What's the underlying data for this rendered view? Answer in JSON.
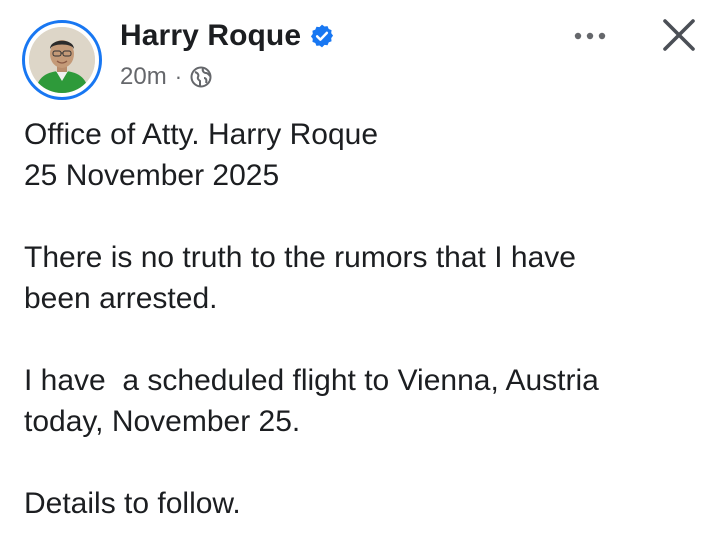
{
  "post": {
    "author": "Harry Roque",
    "verified": true,
    "time": "20m",
    "separator": "·",
    "audience_icon": "globe-icon",
    "more_icon": "more-options-icon",
    "close_icon": "close-icon",
    "paragraphs": [
      [
        "Office of Atty. Harry Roque",
        "25 November 2025"
      ],
      [
        "There is no truth to the rumors that I have",
        "been arrested."
      ],
      [
        "I have  a scheduled flight to Vienna, Austria",
        "today, November 25."
      ],
      [
        "Details to follow."
      ]
    ]
  },
  "colors": {
    "verified_badge": "#1877f2",
    "avatar_ring": "#1877f2",
    "meta_text": "#65676b",
    "text": "#1c1e21"
  }
}
